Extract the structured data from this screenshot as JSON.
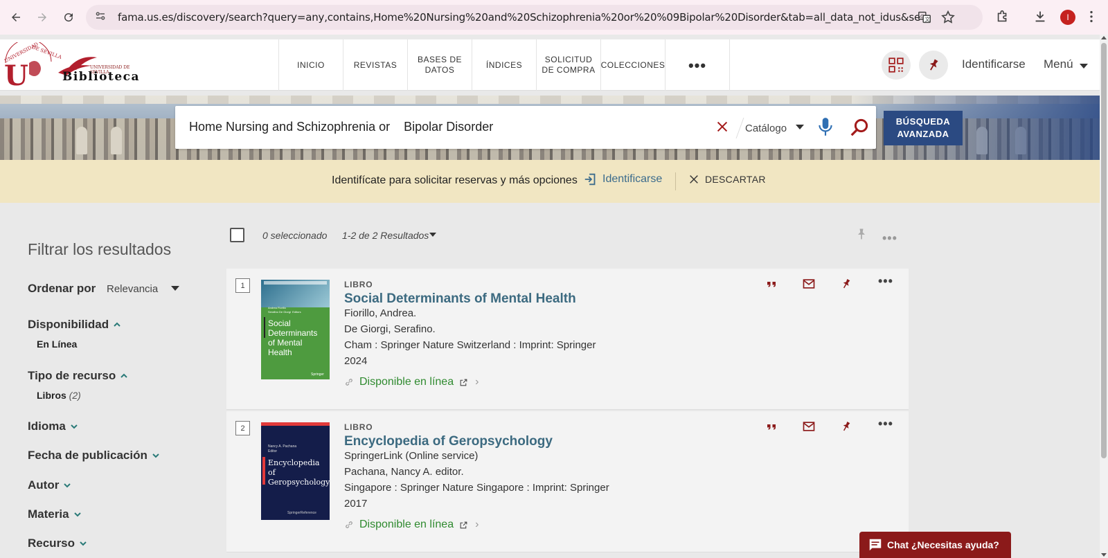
{
  "browser": {
    "url": "fama.us.es/discovery/search?query=any,contains,Home%20Nursing%20and%20Schizophrenia%20or%20%09Bipolar%20Disorder&tab=all_data_not_idus&search_scope=all_data_not...",
    "profile_initial": "I"
  },
  "header": {
    "logo_text": "Biblioteca",
    "logo_sub": "UNIVERSIDAD DE SEVILLA",
    "nav": [
      "INICIO",
      "REVISTAS",
      "BASES DE DATOS",
      "ÍNDICES",
      "SOLICITUD DE COMPRA",
      "COLECCIONES",
      "•••"
    ],
    "login_label": "Identificarse",
    "menu_label": "Menú"
  },
  "search": {
    "query": "Home Nursing and Schizophrenia or    Bipolar Disorder",
    "scope": "Catálogo",
    "advanced_label": "BÚSQUEDA AVANZADA"
  },
  "banner": {
    "message": "Identifícate para solicitar reservas y más opciones",
    "login_label": "Identificarse",
    "dismiss_label": "DESCARTAR"
  },
  "filters": {
    "title": "Filtrar los resultados",
    "sort_label": "Ordenar por",
    "sort_value": "Relevancia",
    "facets": [
      {
        "label": "Disponibilidad",
        "expanded": true,
        "values": [
          {
            "label": "En Línea",
            "count": ""
          }
        ]
      },
      {
        "label": "Tipo de recurso",
        "expanded": true,
        "values": [
          {
            "label": "Libros",
            "count": "(2)"
          }
        ]
      },
      {
        "label": "Idioma",
        "expanded": false
      },
      {
        "label": "Fecha de publicación",
        "expanded": false
      },
      {
        "label": "Autor",
        "expanded": false
      },
      {
        "label": "Materia",
        "expanded": false
      },
      {
        "label": "Recurso",
        "expanded": false
      }
    ]
  },
  "results_header": {
    "selected": "0 seleccionado",
    "count": "1-2 de 2 Resultados"
  },
  "results": [
    {
      "num": "1",
      "type": "LIBRO",
      "title": "Social Determinants of Mental Health",
      "lines": [
        "Fiorillo, Andrea.",
        "De Giorgi, Serafino.",
        "Cham : Springer Nature Switzerland : Imprint: Springer",
        "2024"
      ],
      "availability": "Disponible en línea",
      "cover_title": "Social Determinants of Mental Health",
      "cover_authors": "Andrea Fiorillo\nSerafino De Giorgi  Editors",
      "cover_publisher": "Springer",
      "cover_color": "#4e9b3f"
    },
    {
      "num": "2",
      "type": "LIBRO",
      "title": "Encyclopedia of Geropsychology",
      "lines": [
        "SpringerLink (Online service)",
        "Pachana, Nancy A. editor.",
        "Singapore : Springer Nature Singapore : Imprint: Springer",
        "2017"
      ],
      "availability": "Disponible en línea",
      "cover_title": "Encyclopedia of Geropsychology",
      "cover_authors": "Nancy A. Pachana\nEditor",
      "cover_publisher": "SpringerReference",
      "cover_color": "#141d4a"
    }
  ],
  "chat": {
    "label": "Chat ¿Necesitas ayuda?"
  },
  "colors": {
    "accent": "#8b1a1a",
    "title_link": "#3c6a80",
    "available": "#2f8a2f",
    "banner": "#f1e6c2"
  }
}
